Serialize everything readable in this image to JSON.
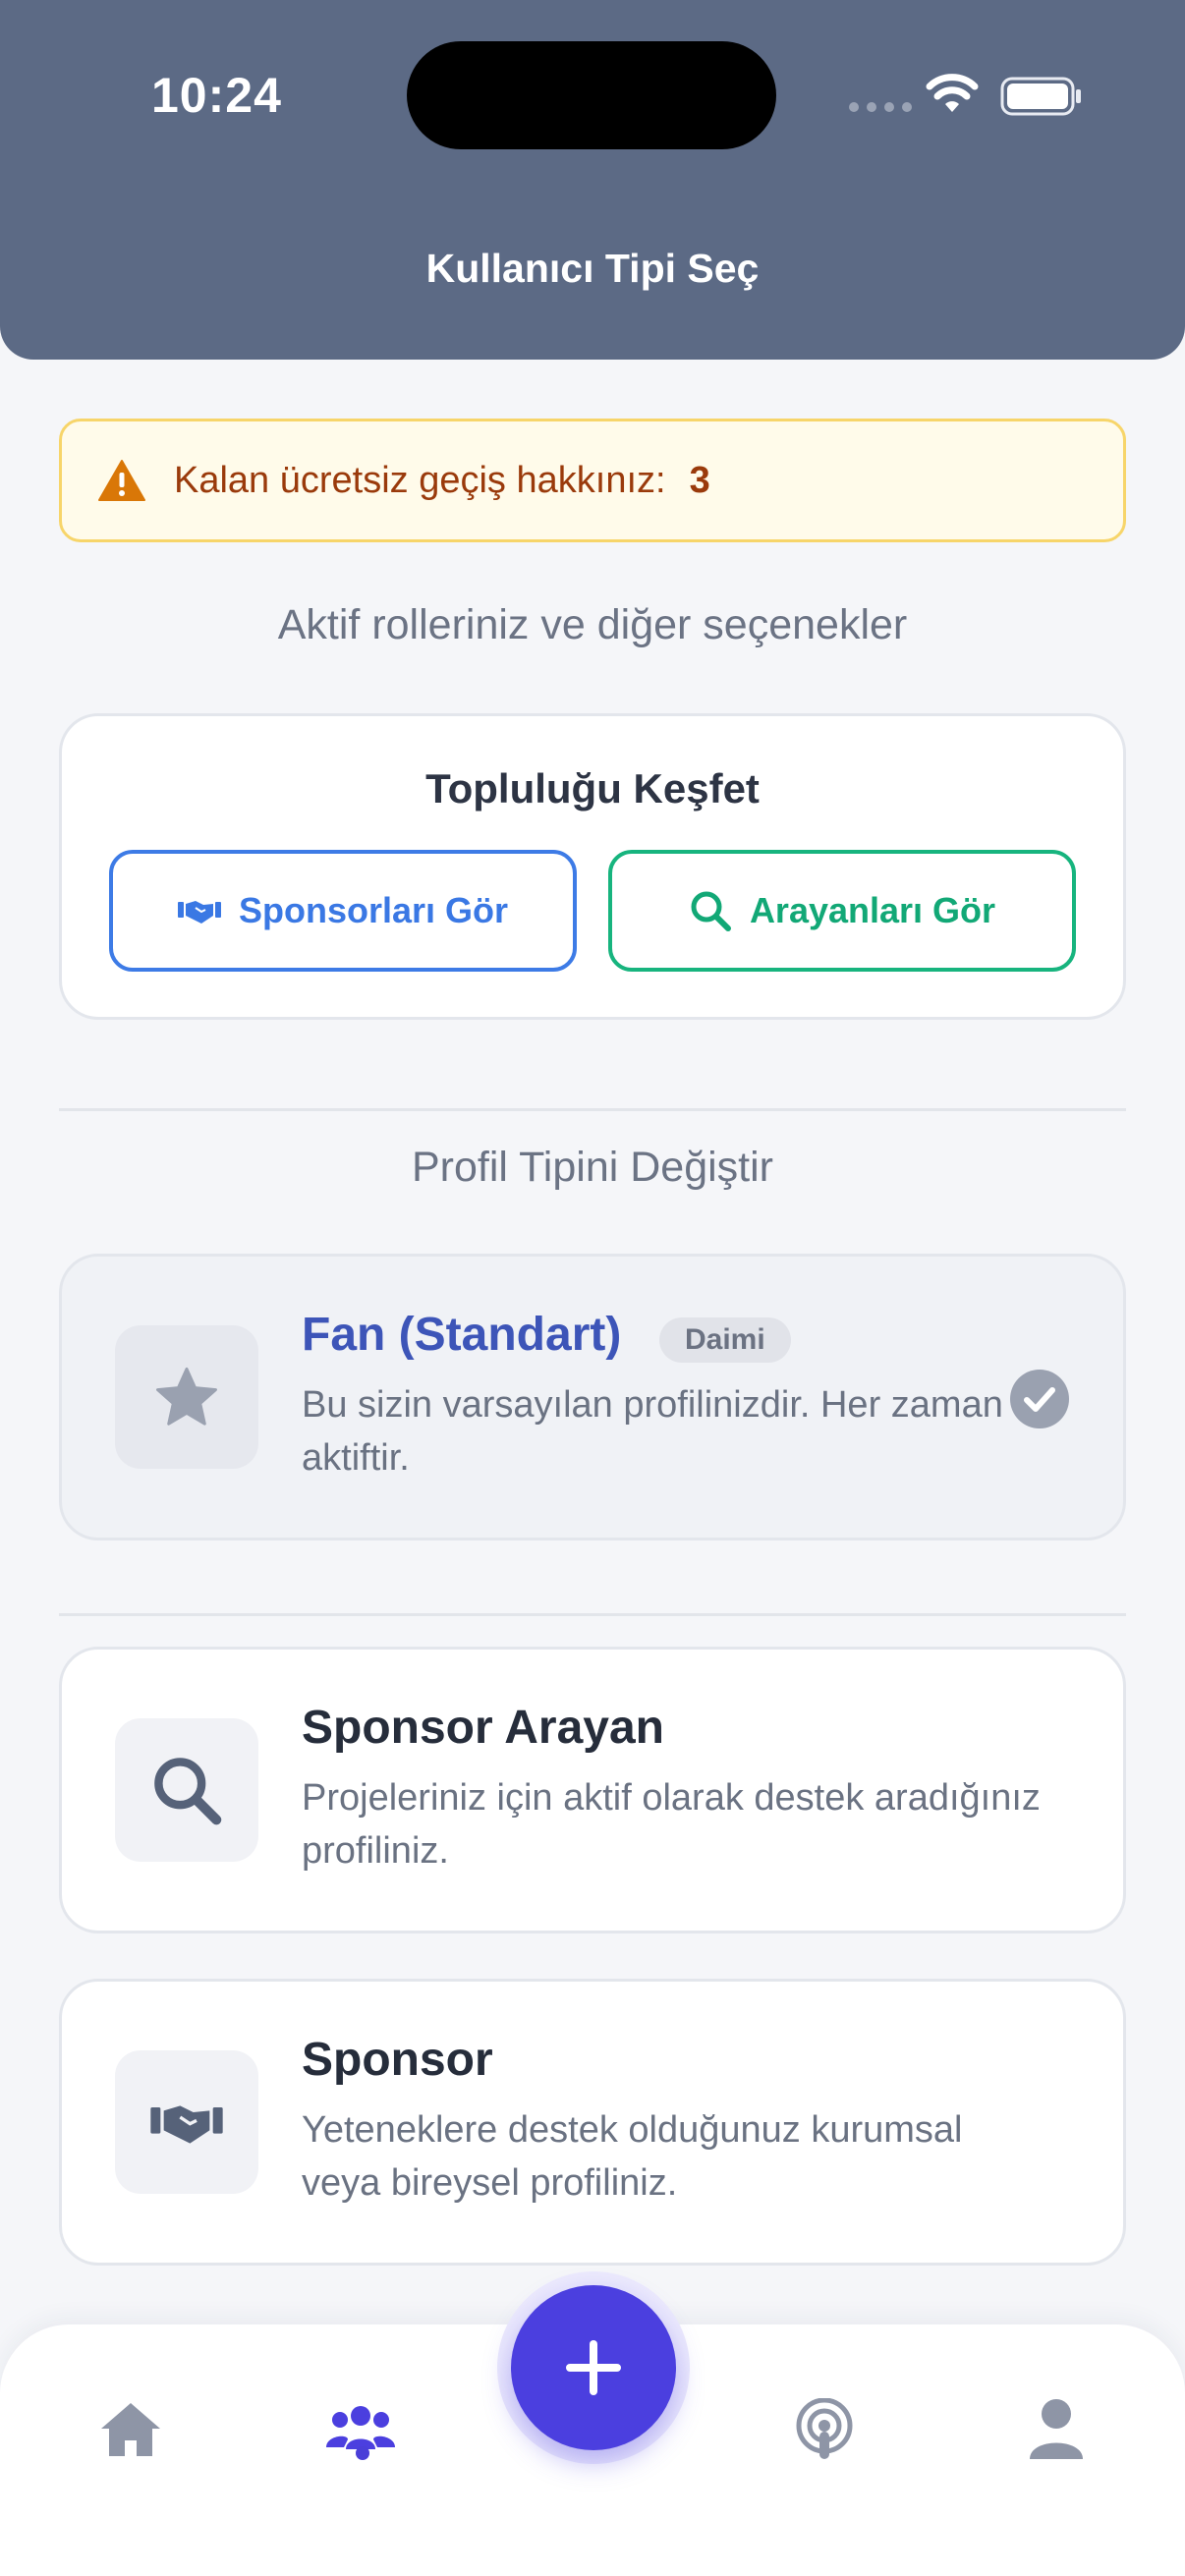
{
  "status_bar": {
    "time": "10:24"
  },
  "header": {
    "title": "Kullanıcı Tipi Seç"
  },
  "warning": {
    "text": "Kalan ücretsiz geçiş hakkınız:",
    "count": "3"
  },
  "roles_caption": "Aktif rolleriniz ve diğer seçenekler",
  "discover": {
    "title": "Topluluğu Keşfet",
    "sponsors_button": "Sponsorları Gör",
    "seekers_button": "Arayanları Gör"
  },
  "change_caption": "Profil Tipini Değiştir",
  "profiles": [
    {
      "title": "Fan (Standart)",
      "badge": "Daimi",
      "description": "Bu sizin varsayılan profilinizdir. Her zaman aktiftir.",
      "icon": "star-icon",
      "active": true
    },
    {
      "title": "Sponsor Arayan",
      "description": "Projeleriniz için aktif olarak destek aradığınız profiliniz.",
      "icon": "search-icon",
      "active": false
    },
    {
      "title": "Sponsor",
      "description": "Yeteneklere destek olduğunuz kurumsal veya bireysel profiliniz.",
      "icon": "handshake-icon",
      "active": false
    }
  ],
  "nav": {
    "items": [
      "home-icon",
      "community-icon",
      "add-icon",
      "podcast-icon",
      "user-icon"
    ],
    "selected": "community-icon"
  },
  "colors": {
    "header_bg": "#5c6a85",
    "accent": "#4b3fdf",
    "sponsors_blue": "#3a78e4",
    "seekers_green": "#12a876",
    "warning_text": "#9a3a0b"
  }
}
